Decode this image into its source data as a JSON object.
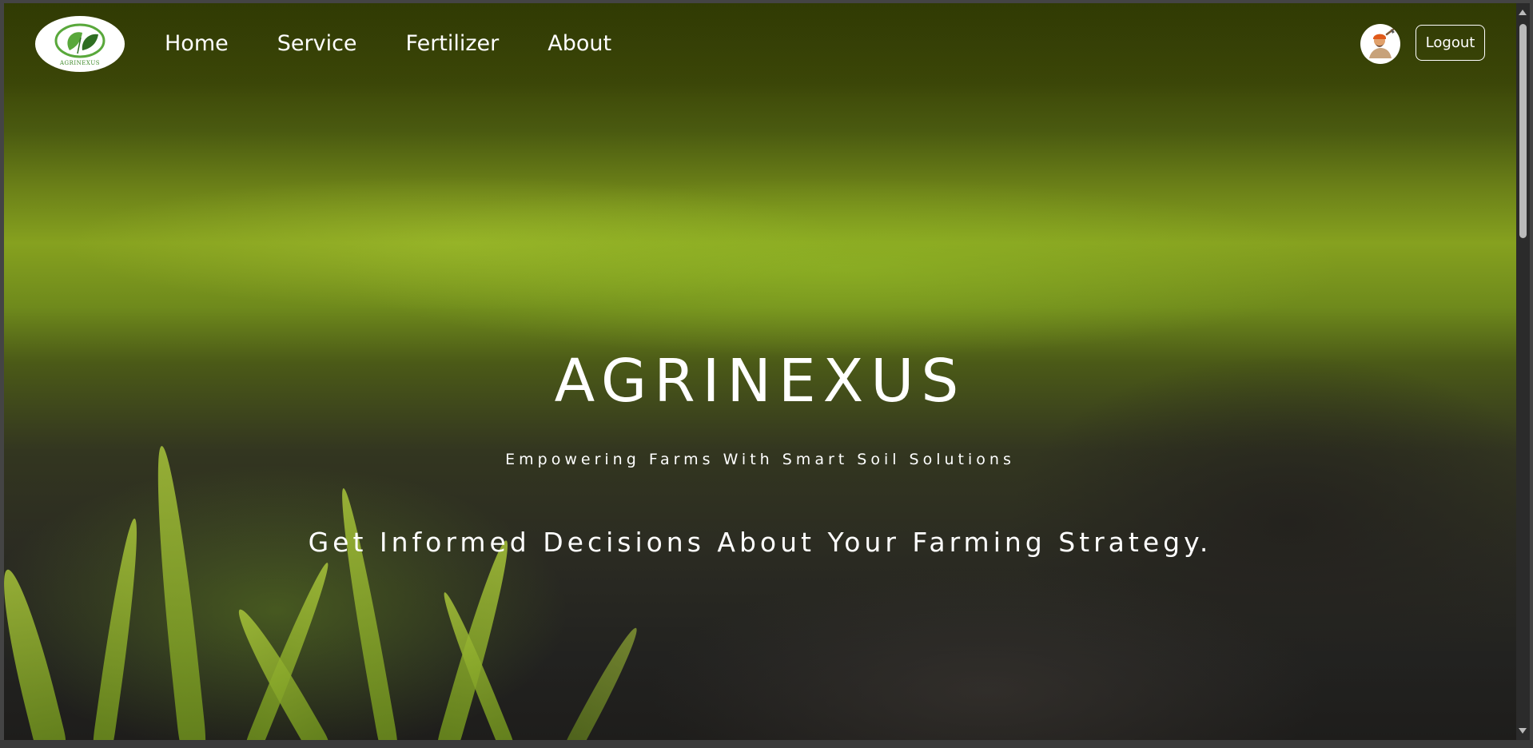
{
  "navbar": {
    "logo_text": "AGRINEXUS",
    "links": [
      {
        "label": "Home"
      },
      {
        "label": "Service"
      },
      {
        "label": "Fertilizer"
      },
      {
        "label": "About"
      }
    ],
    "logout_label": "Logout"
  },
  "hero": {
    "title": "AGRINEXUS",
    "subtitle": "Empowering Farms With Smart Soil Solutions",
    "tagline": "Get Informed Decisions About Your Farming Strategy."
  },
  "colors": {
    "text": "#ffffff",
    "logo_green": "#3f8a2a",
    "navbar_tint": "#3a4406"
  },
  "icons": [
    "leaf-logo-icon",
    "user-avatar-icon"
  ]
}
